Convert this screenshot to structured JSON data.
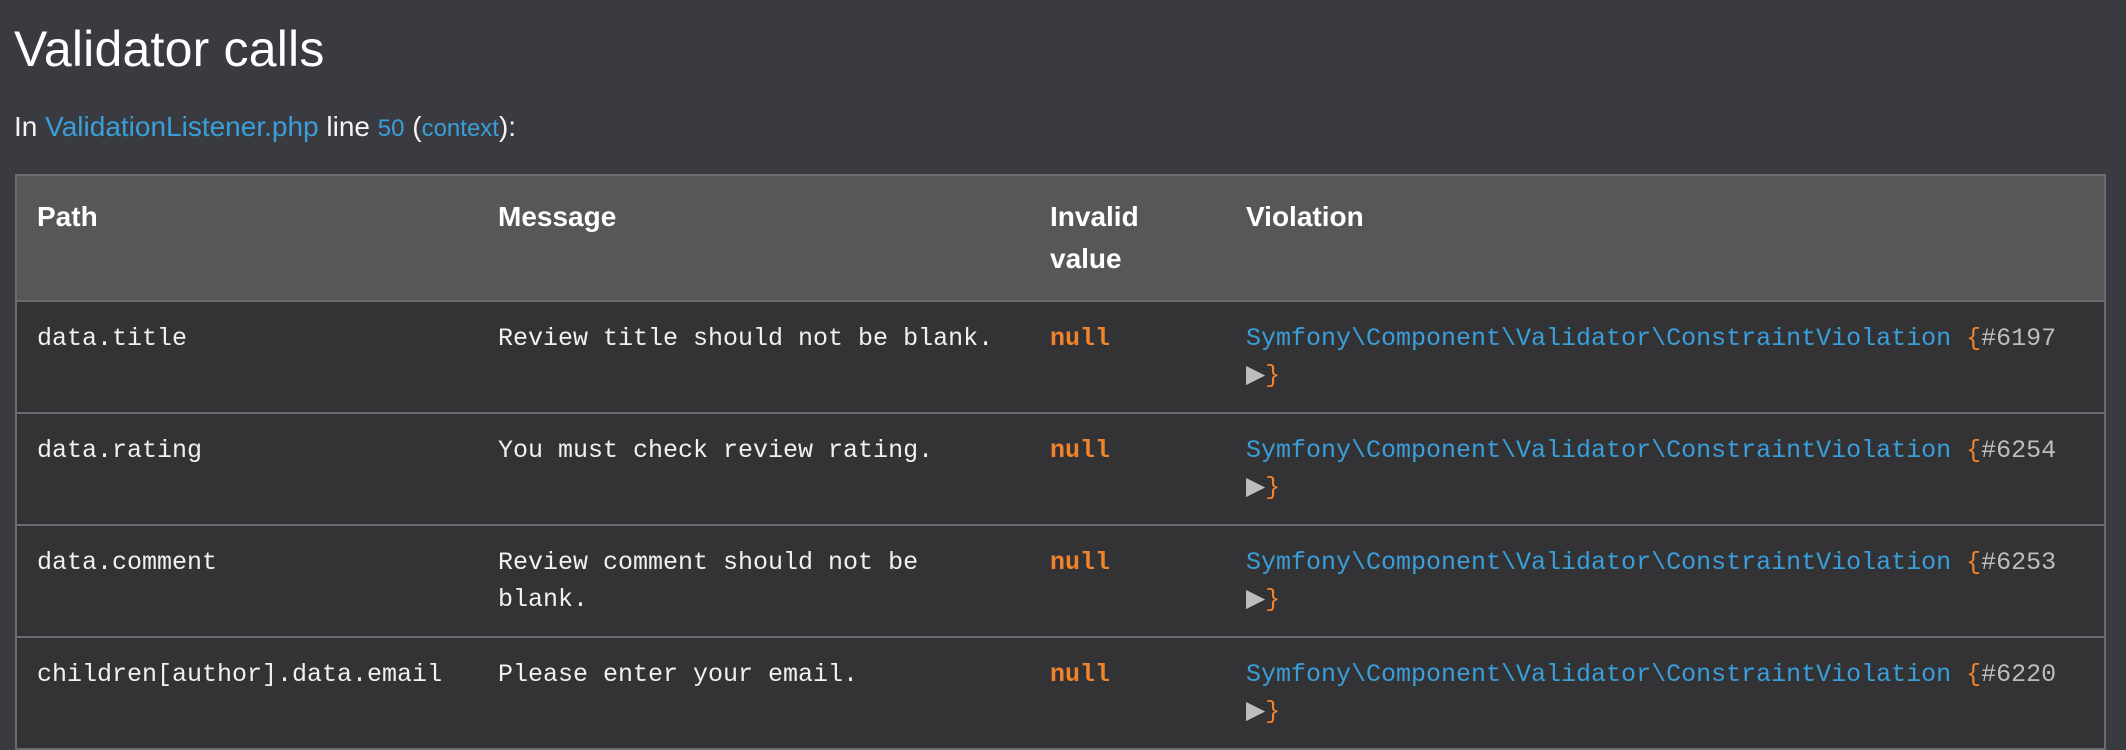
{
  "page": {
    "title": "Validator calls"
  },
  "location": {
    "prefix": "In",
    "file_label": "ValidationListener.php",
    "line_word": "line",
    "line_number": "50",
    "open_paren": "(",
    "context_label": "context",
    "close_paren": "):"
  },
  "table": {
    "headers": {
      "path": "Path",
      "message": "Message",
      "invalid_value_line1": "Invalid",
      "invalid_value_line2": "value",
      "violation": "Violation"
    },
    "rows": [
      {
        "path": "data.title",
        "message": "Review title should not be blank.",
        "invalid_value": "null",
        "violation_class": "Symfony\\Component\\Validator\\ConstraintViolation",
        "brace_open": "{",
        "object_id": "#6197",
        "toggle": "▶",
        "brace_close": "}"
      },
      {
        "path": "data.rating",
        "message": "You must check review rating.",
        "invalid_value": "null",
        "violation_class": "Symfony\\Component\\Validator\\ConstraintViolation",
        "brace_open": "{",
        "object_id": "#6254",
        "toggle": "▶",
        "brace_close": "}"
      },
      {
        "path": "data.comment",
        "message": "Review comment should not be blank.",
        "invalid_value": "null",
        "violation_class": "Symfony\\Component\\Validator\\ConstraintViolation",
        "brace_open": "{",
        "object_id": "#6253",
        "toggle": "▶",
        "brace_close": "}"
      },
      {
        "path": "children[author].data.email",
        "message": "Please enter your email.",
        "invalid_value": "null",
        "violation_class": "Symfony\\Component\\Validator\\ConstraintViolation",
        "brace_open": "{",
        "object_id": "#6220",
        "toggle": "▶",
        "brace_close": "}"
      }
    ]
  },
  "colors": {
    "background": "#393b40",
    "link": "#3a9fd8",
    "null_value": "#f0832b",
    "header_bg": "#575757",
    "row_bg": "#333336"
  }
}
